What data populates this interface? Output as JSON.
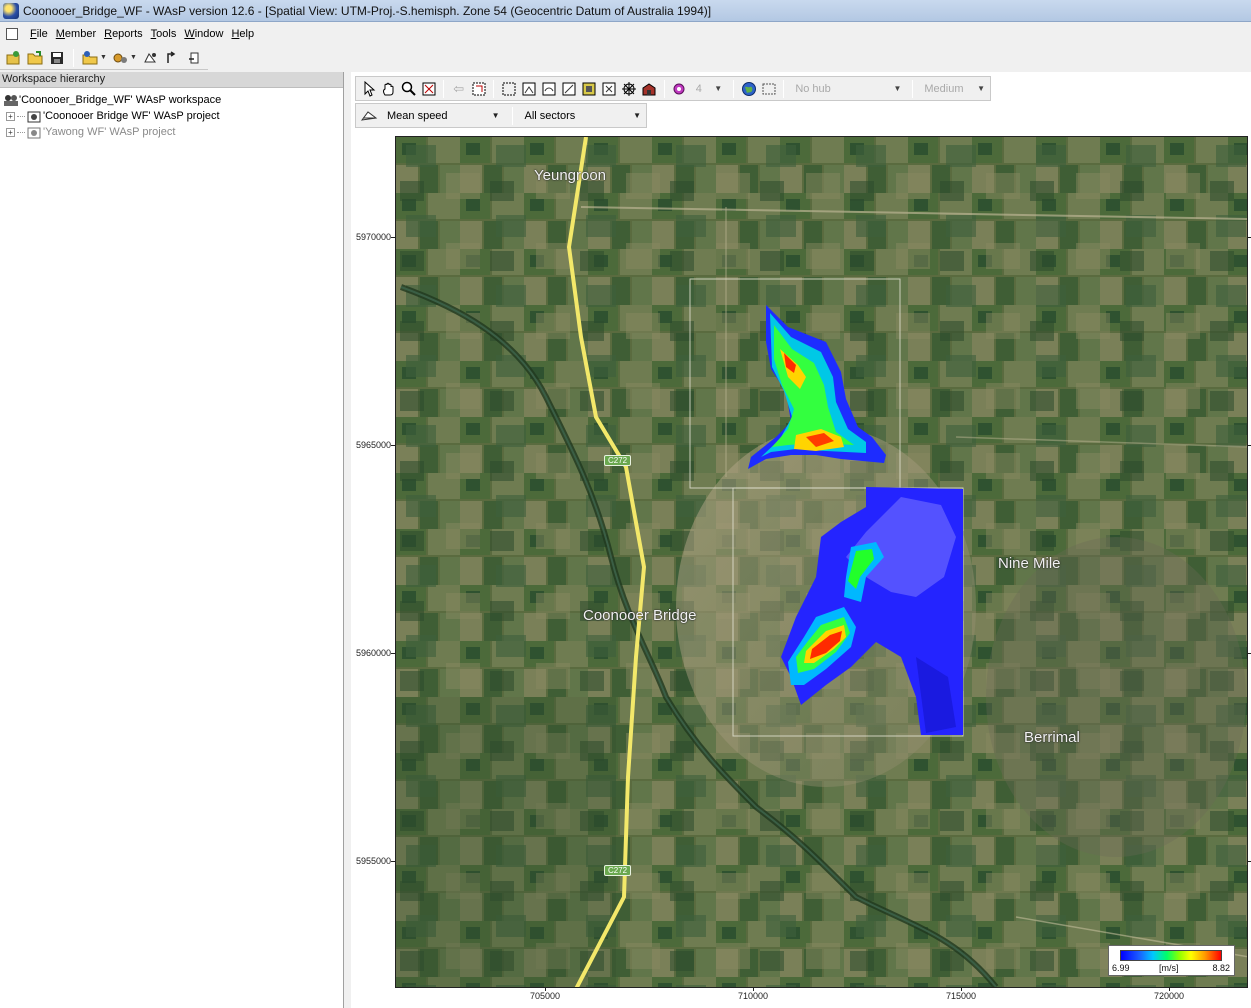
{
  "window": {
    "title": "Coonooer_Bridge_WF - WAsP version 12.6 - [Spatial View: UTM-Proj.-S.hemisph. Zone 54 (Geocentric Datum of Australia 1994)]"
  },
  "menu": {
    "items": [
      "File",
      "Member",
      "Reports",
      "Tools",
      "Window",
      "Help"
    ]
  },
  "workspace": {
    "header": "Workspace hierarchy",
    "items": [
      {
        "label": "'Coonooer_Bridge_WF' WAsP workspace",
        "expandable": false,
        "dimmed": false
      },
      {
        "label": "'Coonooer Bridge WF' WAsP project",
        "expandable": true,
        "dimmed": false
      },
      {
        "label": "'Yawong WF' WAsP project",
        "expandable": true,
        "dimmed": true
      }
    ]
  },
  "view_toolbar": {
    "value_combo": "4",
    "hub_combo": "No hub",
    "detail_combo": "Medium",
    "variable_combo": "Mean speed",
    "sector_combo": "All sectors"
  },
  "map": {
    "y_ticks": [
      "5970000",
      "5965000",
      "5960000",
      "5955000"
    ],
    "x_ticks": [
      "705000",
      "710000",
      "715000",
      "720000"
    ],
    "places": {
      "yeungroon": "Yeungroon",
      "coonooer_bridge": "Coonooer Bridge",
      "nine_mile": "Nine Mile",
      "berrimal": "Berrimal"
    },
    "road_badges": [
      "C272",
      "C272"
    ],
    "legend": {
      "min": "6.99",
      "max": "8.82",
      "unit": "[m/s]",
      "colors": [
        "#0000ff",
        "#00c8ff",
        "#00ff66",
        "#ffff00",
        "#ff9900",
        "#ff0000"
      ]
    }
  },
  "icons": [
    "open-workspace-icon",
    "open-folder-icon",
    "save-icon",
    "insert-member-icon",
    "tools-icon",
    "pointer-icon",
    "hand-pan-icon",
    "zoom-icon",
    "globe-icon"
  ]
}
